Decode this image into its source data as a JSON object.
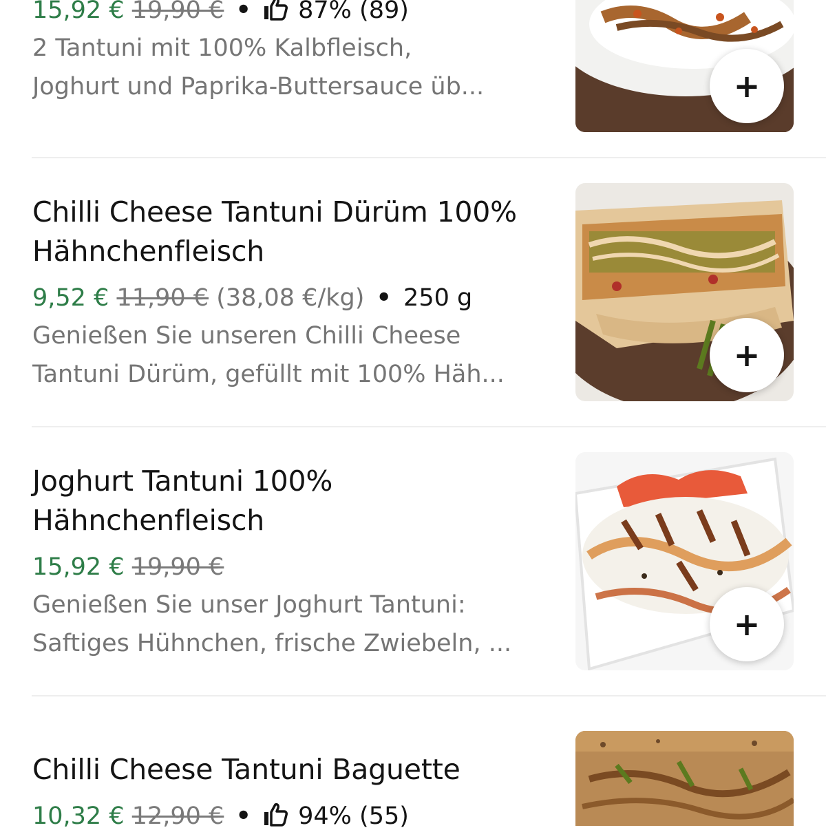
{
  "items": [
    {
      "title": "",
      "price": "15,92 €",
      "old_price": "19,90 €",
      "rating": "87% (89)",
      "desc_line1": "2 Tantuni mit 100% Kalbfleisch,",
      "desc_line2": "Joghurt und Paprika-Buttersauce üb..."
    },
    {
      "title": "Chilli Cheese Tantuni Dürüm 100% Hähnchenfleisch",
      "price": "9,52 €",
      "old_price": "11,90 €",
      "unit_price": "(38,08 €/kg)",
      "weight": "250 g",
      "desc_line1": "Genießen Sie unseren Chilli Cheese",
      "desc_line2": "Tantuni Dürüm, gefüllt mit 100% Häh..."
    },
    {
      "title": "Joghurt Tantuni 100% Hähnchenfleisch",
      "price": "15,92 €",
      "old_price": "19,90 €",
      "desc_line1": "Genießen Sie unser Joghurt Tantuni:",
      "desc_line2": "Saftiges Hühnchen, frische Zwiebeln, ..."
    },
    {
      "title": "Chilli Cheese Tantuni Baguette",
      "price": "10,32 €",
      "old_price": "12,90 €",
      "rating": "94% (55)"
    }
  ],
  "add_label": "+",
  "icons": {
    "rating": "thumbs-up-icon",
    "add": "plus-icon"
  },
  "colors": {
    "price_green": "#2e7d48",
    "text": "#141414",
    "muted": "#757575"
  }
}
